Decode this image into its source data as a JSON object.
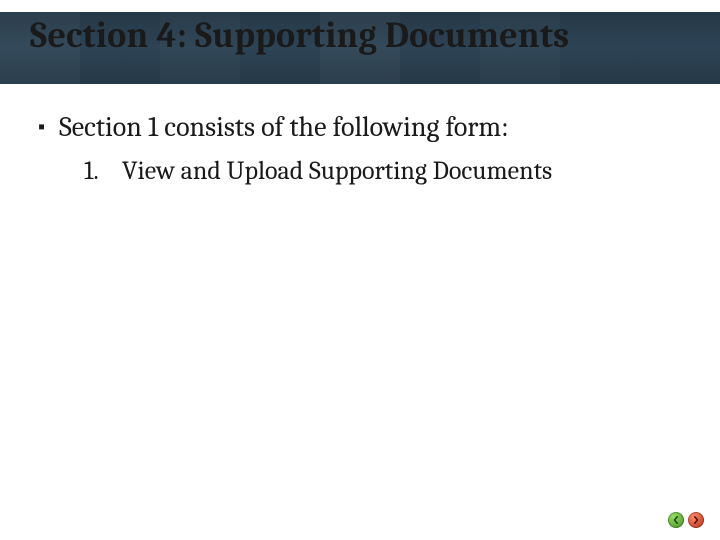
{
  "title": "Section 4: Supporting Documents",
  "bullet": {
    "text": "Section 1 consists of the following form:"
  },
  "list": {
    "items": [
      {
        "num": "1.",
        "text": "View and Upload Supporting Documents"
      }
    ]
  },
  "nav": {
    "prev_icon": "chevron-left-icon",
    "next_icon": "chevron-right-icon"
  }
}
